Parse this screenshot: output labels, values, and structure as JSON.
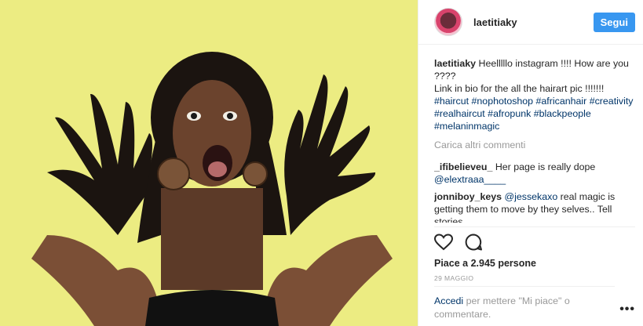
{
  "post": {
    "username": "laetitiaky",
    "follow_label": "Segui",
    "caption": {
      "user": "laetitiaky",
      "text": " Heelllllo instagram !!!! How are you ????\nLink in bio for the all the hairart pic !!!!!!!",
      "hashtags": "#haircut #nophotoshop #africanhair #creativity #realhaircut #afropunk #blackpeople #melaninmagic"
    },
    "load_more": "Carica altri commenti",
    "comments": [
      {
        "user": "_ifibelieveu_",
        "text": " Her page is really dope",
        "mention": "@elextraaa____"
      },
      {
        "user": "jonniboy_keys",
        "mention": "@jessekaxo",
        "text": " real magic is getting them to move by they selves.. Tell stories"
      }
    ],
    "likes": "Piace a 2.945 persone",
    "date": "29 MAGGIO",
    "login": {
      "link": "Accedi",
      "text": " per mettere \"Mi piace\" o commentare."
    },
    "more_options": "•••"
  },
  "icons": {
    "heart": "heart-icon",
    "comment": "comment-icon",
    "more": "more-options-icon"
  },
  "colors": {
    "accent": "#3897f0",
    "link": "#003569",
    "muted": "#999999",
    "photo_background": "#ecec82"
  }
}
